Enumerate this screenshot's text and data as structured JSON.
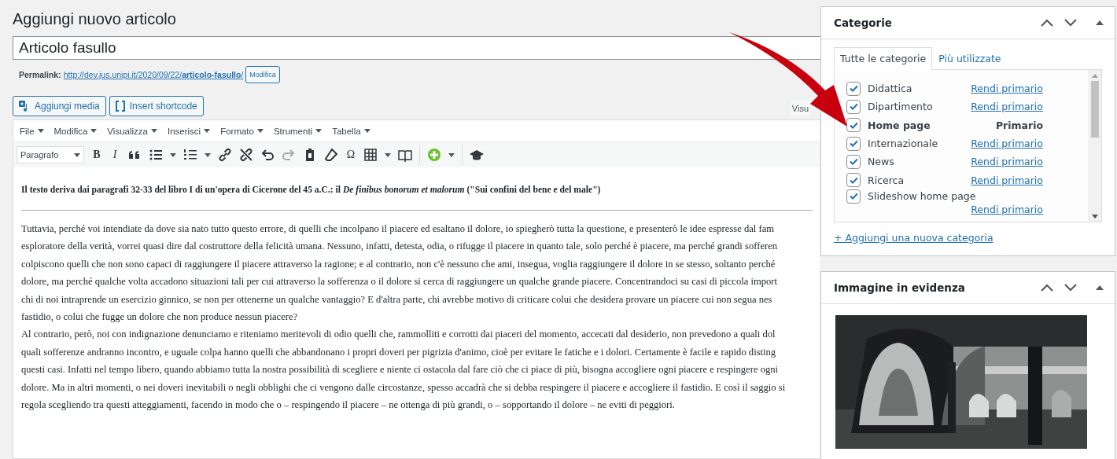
{
  "page_title": "Aggiungi nuovo articolo",
  "post_title": {
    "value": "Articolo fasullo"
  },
  "permalink": {
    "label": "Permalink:",
    "url": "http://dev.jus.unipi.it/2020/09/22/**articolo-fasullo**/",
    "edit_button": "Modifica"
  },
  "media_buttons": [
    "Aggiungi media",
    "Insert shortcode"
  ],
  "editor_tab": "Visu",
  "menubar": [
    "File",
    "Modifica",
    "Visualizza",
    "Inserisci",
    "Formato",
    "Strumenti",
    "Tabella"
  ],
  "toolbar": [
    {
      "kind": "select",
      "label": "Paragrafo"
    },
    {
      "kind": "bold",
      "label": "B"
    },
    {
      "kind": "italic",
      "label": "I"
    },
    {
      "kind": "quote"
    },
    {
      "kind": "bullets"
    },
    {
      "kind": "numbers"
    },
    {
      "kind": "link"
    },
    {
      "kind": "unlink"
    },
    {
      "kind": "undo"
    },
    {
      "kind": "redo"
    },
    {
      "kind": "paste"
    },
    {
      "kind": "eraser"
    },
    {
      "kind": "symbol",
      "label": "Ω"
    },
    {
      "kind": "table"
    },
    {
      "kind": "book"
    },
    {
      "kind": "add"
    },
    {
      "kind": "cap"
    }
  ],
  "content": {
    "intro": "Il testo deriva dai paragrafi 32-33 del libro I di un'opera di Cicerone del 45 a.C.: il *De finibus bonorum et malorum* (\"Sui confini del bene e del male\")",
    "lines": [
      "Tuttavia, perché voi intendiate da dove sia nato tutto questo errore, di quelli che incolpano il piacere ed esaltano il dolore, io spiegherò tutta la questione, e presenterò le idee espresse dal fam",
      "esploratore della verità, vorrei quasi dire dal costruttore della felicità umana. Nessuno, infatti, detesta, odia, o rifugge il piacere in quanto tale, solo perché è piacere, ma perché grandi sofferen",
      "colpiscono quelli che non sono capaci di raggiungere il piacere attraverso la ragione; e al contrario, non c'è nessuno che ami, insegua, voglia raggiungere il dolore in se stesso, soltanto perché",
      "dolore, ma perché qualche volta accadono situazioni tali per cui attraverso la sofferenza o il dolore si cerca di raggiungere un qualche grande piacere. Concentrandoci su casi di piccola import",
      "chi di noi intraprende un esercizio ginnico, se non per ottenerne un qualche vantaggio? E d'altra parte, chi avrebbe motivo di criticare colui che desidera provare un piacere cui non segua nes",
      "fastidio, o colui che fugge un dolore che non produce nessun piacere?",
      "Al contrario, però, noi con indignazione denunciamo e riteniamo meritevoli di odio quelli che, rammolliti e corrotti dai piaceri del momento, accecati dal desiderio, non prevedono a quali dol",
      "quali sofferenze andranno incontro, e uguale colpa hanno quelli che abbandonano i propri doveri per pigrizia d'animo, cioè per evitare le fatiche e i dolori. Certamente è facile e rapido disting",
      "questi casi. Infatti nel tempo libero, quando abbiamo tutta la nostra possibilità di scegliere e niente ci ostacola dal fare ciò che ci piace di più, bisogna accogliere ogni piacere e respingere ogni",
      "dolore. Ma in altri momenti, o nei doveri inevitabili o negli obblighi che ci vengono dalle circostanze, spesso accadrà che si debba respingere il piacere e accogliere il fastidio. E così il saggio si",
      "regola scegliendo tra questi atteggiamenti, facendo in modo che o – respingendo il piacere – ne ottenga di più grandi, o – sopportando il dolore – ne eviti di peggiori."
    ]
  },
  "categories": {
    "title": "Categorie",
    "tabs": [
      {
        "label": "Tutte le categorie",
        "selected": true
      },
      {
        "label": "Più utilizzate",
        "selected": false
      }
    ],
    "items": [
      {
        "label": "Didattica",
        "checked": true,
        "primary": false,
        "action": "Rendi primario"
      },
      {
        "label": "Dipartimento",
        "checked": true,
        "primary": false,
        "action": "Rendi primario"
      },
      {
        "label": "Home page",
        "checked": true,
        "primary": true,
        "action": "Primario"
      },
      {
        "label": "Internazionale",
        "checked": true,
        "primary": false,
        "action": "Rendi primario"
      },
      {
        "label": "News",
        "checked": true,
        "primary": false,
        "action": "Rendi primario"
      },
      {
        "label": "Ricerca",
        "checked": true,
        "primary": false,
        "action": "Rendi primario"
      },
      {
        "label": "Slideshow home page",
        "checked": true,
        "primary": false,
        "action": "Rendi primario"
      }
    ],
    "add_link": "+ Aggiungi una nuova categoria"
  },
  "featured_image": {
    "title": "Immagine in evidenza",
    "kind": "picture"
  }
}
